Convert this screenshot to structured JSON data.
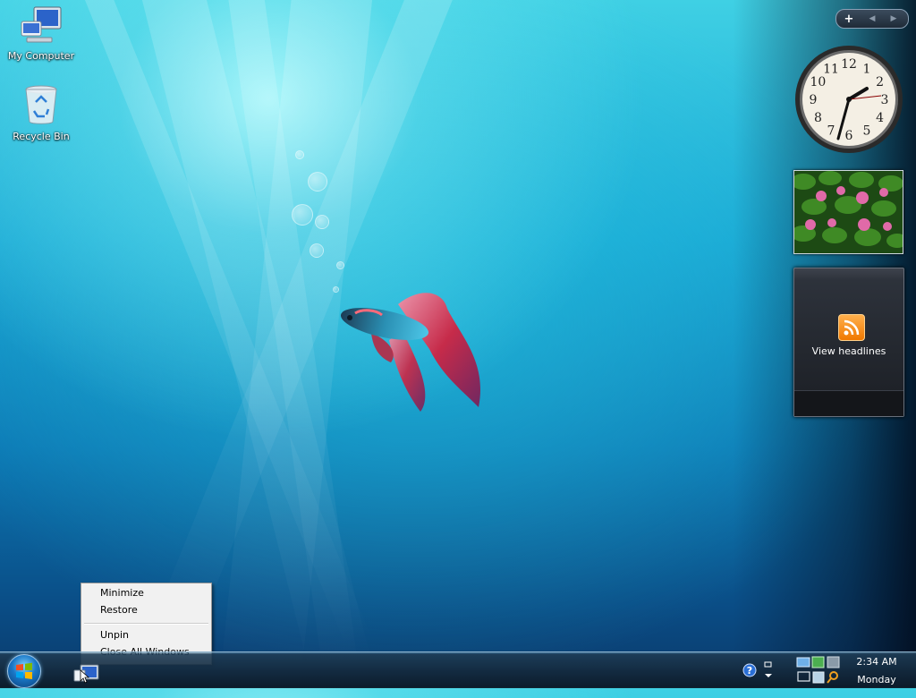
{
  "desktop": {
    "icons": [
      {
        "label": "My Computer",
        "icon": "computer-icon"
      },
      {
        "label": "Recycle Bin",
        "icon": "recycle-bin-icon"
      }
    ]
  },
  "gadgets": {
    "toolbar": {
      "add_label": "+",
      "prev_label": "◀",
      "next_label": "▶"
    },
    "clock": {
      "numerals": [
        "12",
        "1",
        "2",
        "3",
        "4",
        "5",
        "6",
        "7",
        "8",
        "9",
        "10",
        "11"
      ],
      "time": "2:34"
    },
    "feed": {
      "headline_label": "View headlines",
      "icon": "rss-icon"
    }
  },
  "context_menu": {
    "items": [
      "Minimize",
      "Restore",
      "Unpin",
      "Close All Windows"
    ]
  },
  "taskbar": {
    "start_icon": "windows-start-orb",
    "tray": {
      "time": "2:34 AM",
      "day": "Monday"
    }
  },
  "colors": {
    "accent": "#1aa7d4",
    "taskbar": "#142a3e"
  }
}
